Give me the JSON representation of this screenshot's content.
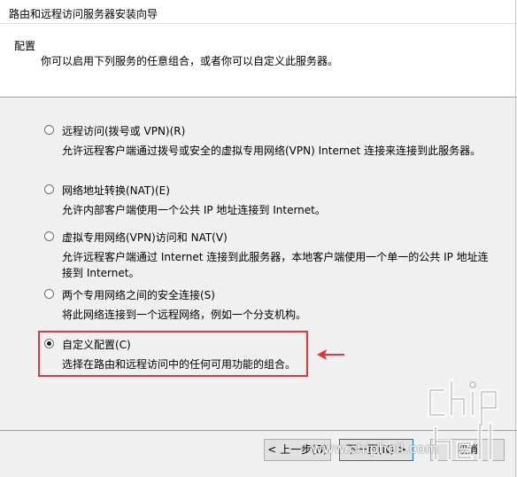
{
  "window": {
    "title": "路由和远程访问服务器安装向导"
  },
  "header": {
    "title": "配置",
    "subtitle": "你可以启用下列服务的任意组合，或者你可以自定义此服务器。"
  },
  "options": [
    {
      "label": "远程访问(拨号或 VPN)(R)",
      "description": "允许远程客户端通过拨号或安全的虚拟专用网络(VPN) Internet 连接来连接到此服务器。",
      "checked": false
    },
    {
      "label": "网络地址转换(NAT)(E)",
      "description": "允许内部客户端使用一个公共 IP 地址连接到 Internet。",
      "checked": false
    },
    {
      "label": "虚拟专用网络(VPN)访问和 NAT(V)",
      "description": "允许远程客户端通过 Internet 连接到此服务器，本地客户端使用一个单一的公共 IP 地址连接到 Internet。",
      "checked": false
    },
    {
      "label": "两个专用网络之间的安全连接(S)",
      "description": "将此网络连接到一个远程网络，例如一个分支机构。",
      "checked": false
    },
    {
      "label": "自定义配置(C)",
      "description": "选择在路由和远程访问中的任何可用功能的组合。",
      "checked": true
    }
  ],
  "buttons": {
    "back": "< 上一步(B)",
    "next": "下一页(N) >",
    "cancel": "取消"
  },
  "watermark": {
    "url": "www.chiphell.com"
  },
  "colors": {
    "highlight": "#e0373a",
    "accent": "#0078d7"
  }
}
